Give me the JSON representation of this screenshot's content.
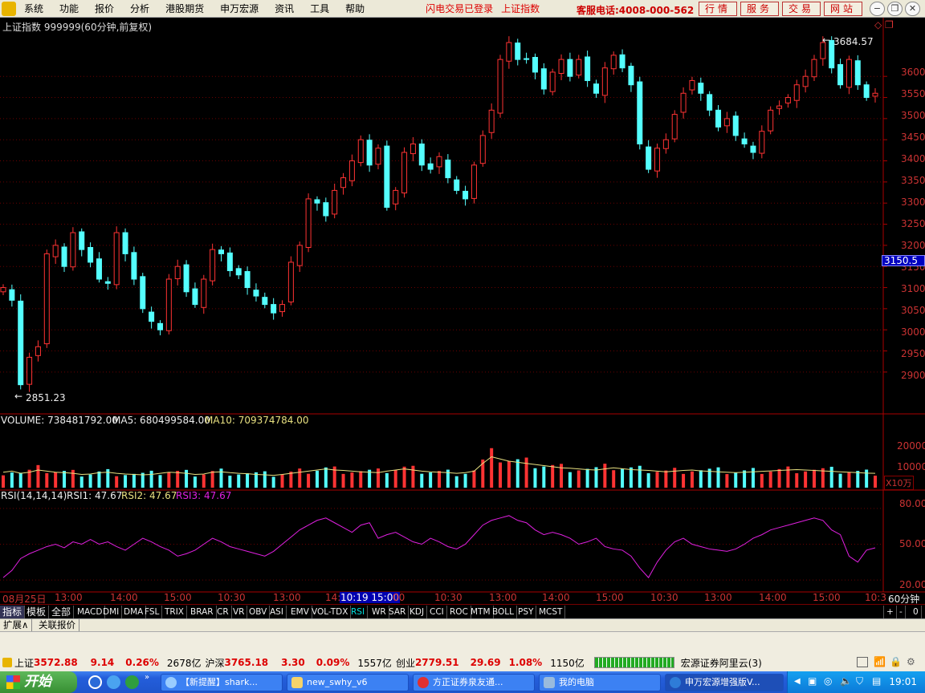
{
  "menu": {
    "items": [
      "系统",
      "功能",
      "报价",
      "分析",
      "港股期货",
      "申万宏源",
      "资讯",
      "工具",
      "帮助"
    ],
    "status_login": "闪电交易已登录",
    "status_index": "上证指数",
    "hotline": "客服电话:4008-000-562",
    "buttons": [
      "行情",
      "服务",
      "交易",
      "网站"
    ]
  },
  "chart": {
    "title": "上证指数 999999(60分钟,前复权)",
    "high_label": "3684.57",
    "low_label": "2851.23",
    "cursor_price": "3150.5",
    "price_ticks": [
      "3600",
      "3550",
      "3500",
      "3450",
      "3400",
      "3350",
      "3300",
      "3250",
      "3200",
      "3150",
      "3100",
      "3050",
      "3000",
      "2950",
      "2900"
    ],
    "volume_label": "VOLUME: 738481792.00",
    "ma5_label": "MA5: 680499584.00",
    "ma10_label": "MA10: 709374784.00",
    "volume_ticks": [
      "20000",
      "10000"
    ],
    "volume_unit": "X10万",
    "rsi_label": "RSI(14,14,14)",
    "rsi1_label": "RSI1: 47.67",
    "rsi2_label": "RSI2: 47.67",
    "rsi3_label": "RSI3: 47.67",
    "rsi_ticks": [
      "80.00",
      "50.00",
      "20.00"
    ],
    "x_labels": [
      "08月25日",
      "13:00",
      "14:00",
      "15:00",
      "10:30",
      "13:00",
      "14:",
      "10:19 15:00",
      "00",
      "10:30",
      "13:00",
      "14:00",
      "15:00",
      "10:30",
      "13:00",
      "14:00",
      "15:00",
      "10:3"
    ],
    "period": "60分钟"
  },
  "chart_data": {
    "type": "candlestick",
    "xlabel": "",
    "ylabel": "",
    "ylim": [
      2820,
      3720
    ],
    "price_close": [
      3100,
      3070,
      2870,
      2935,
      2960,
      3180,
      3200,
      3150,
      3230,
      3190,
      3160,
      3120,
      3110,
      3230,
      3180,
      3120,
      3050,
      3020,
      3000,
      3120,
      3150,
      3090,
      3060,
      3120,
      3190,
      3180,
      3140,
      3130,
      3100,
      3080,
      3060,
      3040,
      3060,
      3160,
      3200,
      3310,
      3300,
      3270,
      3330,
      3360,
      3400,
      3450,
      3390,
      3430,
      3290,
      3330,
      3420,
      3440,
      3390,
      3380,
      3410,
      3360,
      3330,
      3310,
      3390,
      3460,
      3520,
      3640,
      3680,
      3640,
      3640,
      3610,
      3570,
      3610,
      3640,
      3600,
      3640,
      3590,
      3560,
      3620,
      3650,
      3620,
      3580,
      3440,
      3380,
      3430,
      3450,
      3510,
      3560,
      3590,
      3560,
      3520,
      3480,
      3500,
      3460,
      3440,
      3420,
      3470,
      3520,
      3530,
      3550,
      3580,
      3600,
      3640,
      3680,
      3620,
      3580,
      3640,
      3580,
      3550,
      3560
    ],
    "volume_line": [
      7000,
      7500,
      6500,
      7000,
      8000,
      7500,
      7000,
      6800,
      6500,
      6000,
      6200,
      6800,
      7000,
      6500,
      6200,
      6000,
      5800,
      6000,
      6500,
      7000,
      6800,
      6500,
      6000,
      6200,
      7000,
      7200,
      6800,
      6500,
      6300,
      6000,
      5800,
      5600,
      6000,
      6500,
      7000,
      7500,
      8000,
      8500,
      8000,
      7800,
      7500,
      7200,
      7000,
      6800,
      7500,
      8000,
      8500,
      8000,
      7500,
      7200,
      7000,
      6800,
      6500,
      6800,
      7500,
      11000,
      14000,
      13000,
      12000,
      11500,
      11000,
      10500,
      10000,
      9500,
      9000,
      8800,
      8500,
      8200,
      8000,
      8500,
      9000,
      8600,
      8200,
      8000,
      7800,
      7500,
      7200,
      7500,
      7800,
      8000,
      7600,
      7400,
      7200,
      7000,
      6800,
      7000,
      7200,
      7400,
      7600,
      7800,
      8000,
      8200,
      8000,
      7800,
      7600,
      7400,
      7200,
      7000,
      6800,
      6600,
      6500
    ],
    "rsi": [
      22,
      28,
      38,
      42,
      45,
      48,
      50,
      47,
      52,
      50,
      54,
      50,
      52,
      48,
      45,
      50,
      55,
      52,
      48,
      45,
      40,
      42,
      45,
      50,
      55,
      52,
      48,
      46,
      44,
      42,
      40,
      44,
      50,
      56,
      62,
      66,
      70,
      72,
      68,
      64,
      60,
      66,
      68,
      55,
      58,
      60,
      56,
      52,
      50,
      55,
      52,
      48,
      46,
      50,
      58,
      66,
      70,
      72,
      74,
      70,
      68,
      62,
      58,
      60,
      58,
      55,
      50,
      52,
      55,
      48,
      46,
      45,
      40,
      30,
      22,
      35,
      45,
      52,
      55,
      50,
      48,
      46,
      45,
      44,
      46,
      50,
      55,
      58,
      62,
      64,
      66,
      68,
      70,
      72,
      70,
      62,
      58,
      40,
      35,
      45,
      47
    ]
  }
}
